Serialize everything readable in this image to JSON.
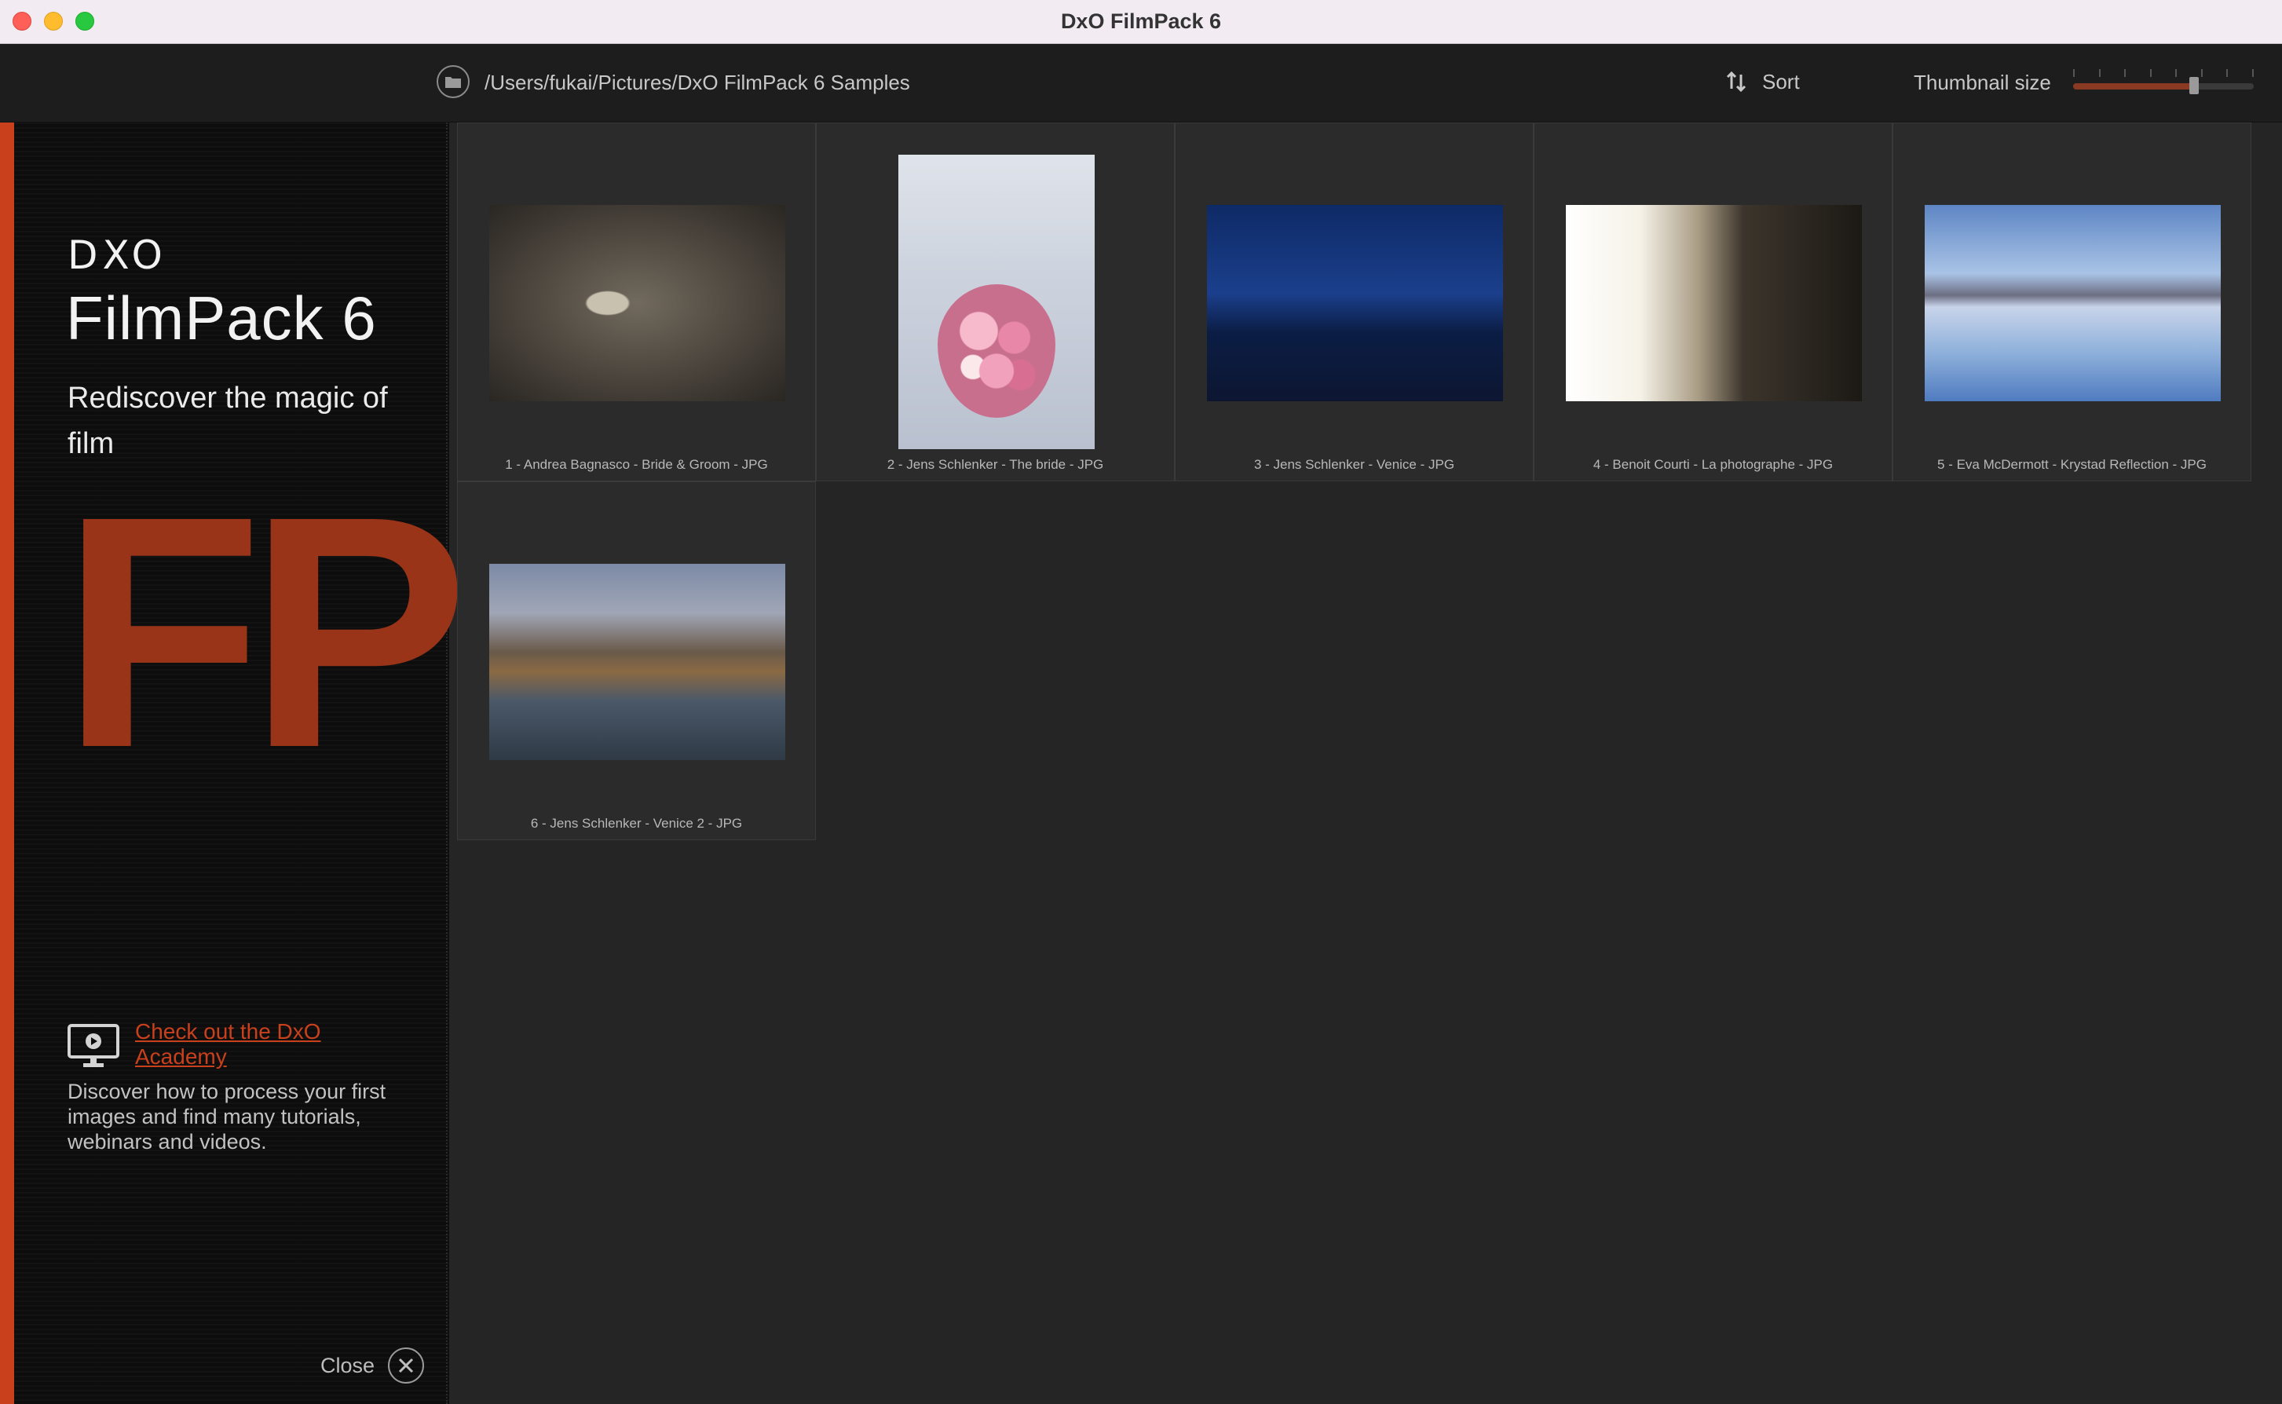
{
  "window": {
    "title": "DxO FilmPack 6"
  },
  "toolbar": {
    "path": "/Users/fukai/Pictures/DxO FilmPack 6 Samples",
    "sort_label": "Sort",
    "thumbnail_size_label": "Thumbnail size",
    "thumbnail_size_fraction": 0.67
  },
  "sidebar": {
    "brand_company": "DXO",
    "brand_product": "FilmPack 6",
    "tagline": "Rediscover the magic of film",
    "logo_letters": "FP",
    "academy_link": "Check out the DxO Academy",
    "academy_description": "Discover how to process your first images and find many tutorials, webinars and videos.",
    "close_label": "Close",
    "accent_color": "#c8401c"
  },
  "thumbnails": [
    {
      "caption": "1 - Andrea Bagnasco - Bride & Groom - JPG",
      "orientation": "landscape",
      "style": "ph-wedding"
    },
    {
      "caption": "2 - Jens Schlenker - The bride - JPG",
      "orientation": "portrait",
      "style": "ph-bride"
    },
    {
      "caption": "3 - Jens Schlenker - Venice - JPG",
      "orientation": "landscape",
      "style": "ph-venice"
    },
    {
      "caption": "4 - Benoit Courti - La photographe - JPG",
      "orientation": "landscape",
      "style": "ph-photographer"
    },
    {
      "caption": "5 - Eva McDermott - Krystad Reflection - JPG",
      "orientation": "landscape",
      "style": "ph-krystad"
    },
    {
      "caption": "6 - Jens Schlenker - Venice 2 - JPG",
      "orientation": "landscape",
      "style": "ph-venice2"
    }
  ]
}
